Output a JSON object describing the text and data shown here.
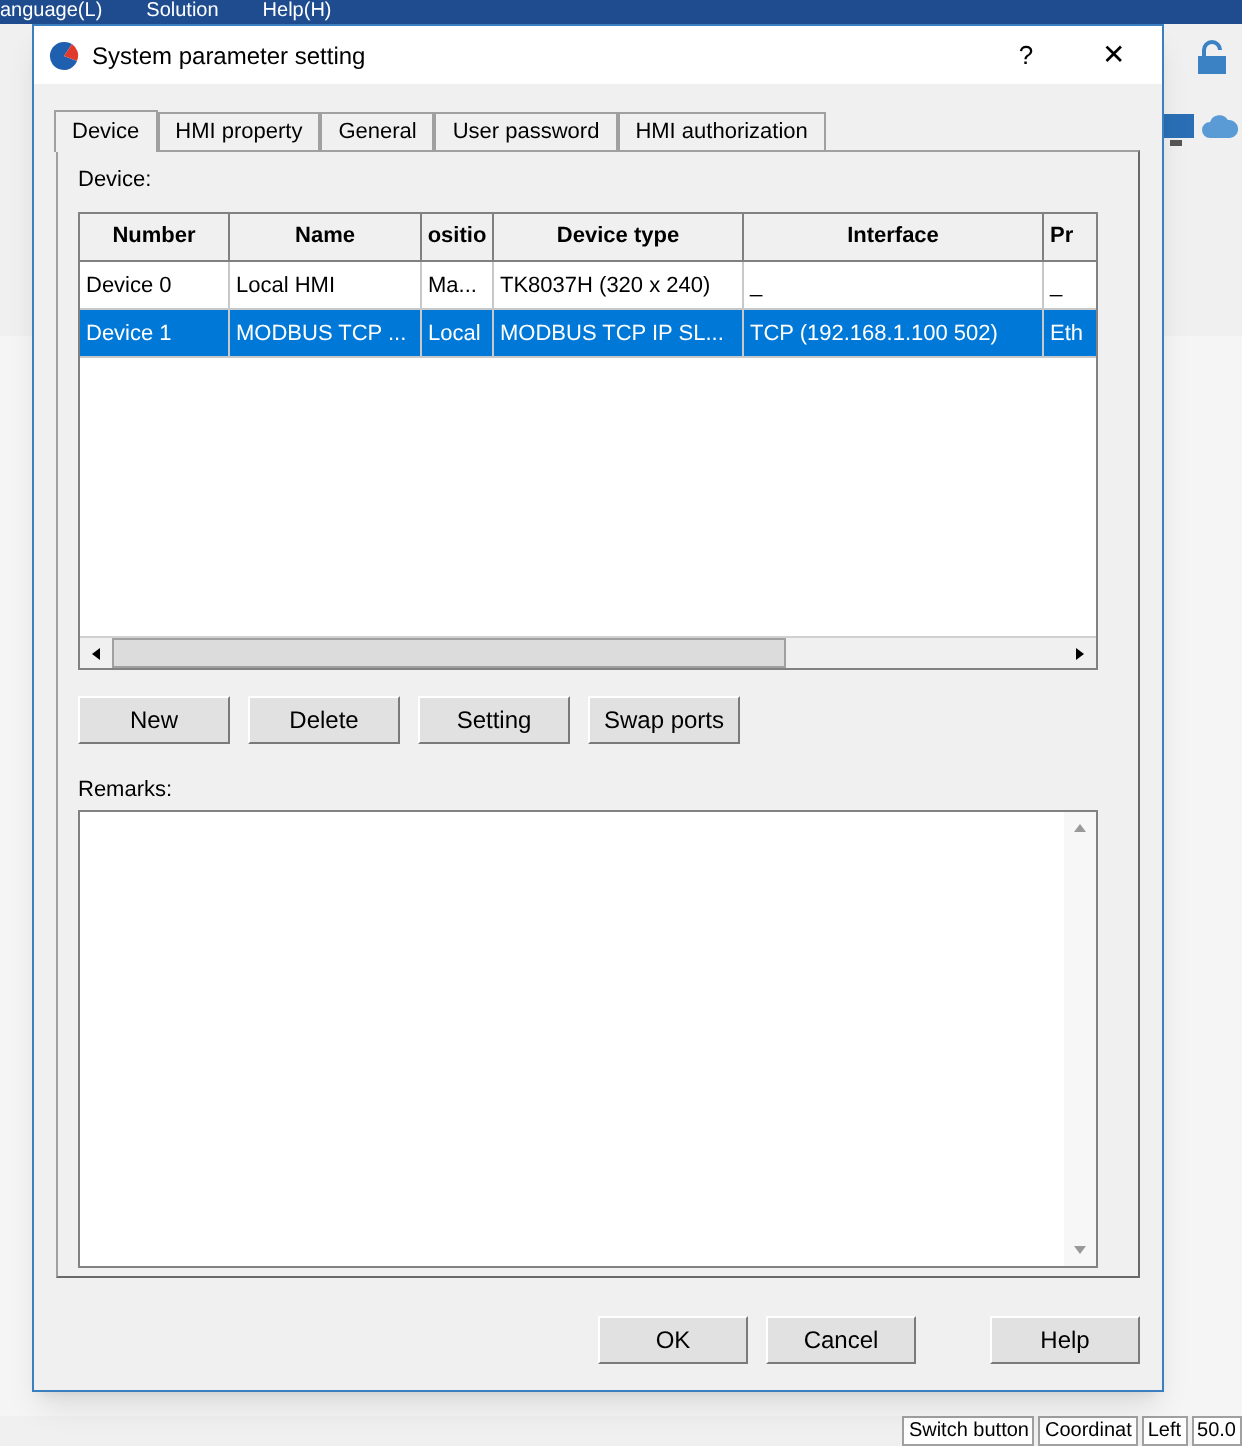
{
  "background_menu": [
    "anguage(L)",
    "Solution",
    "Help(H)"
  ],
  "window": {
    "title": "System parameter setting",
    "help_glyph": "?",
    "close_glyph": "✕"
  },
  "tabs": [
    {
      "label": "Device",
      "selected": true
    },
    {
      "label": "HMI property",
      "selected": false
    },
    {
      "label": "General",
      "selected": false
    },
    {
      "label": "User password",
      "selected": false
    },
    {
      "label": "HMI authorization",
      "selected": false
    }
  ],
  "device_label": "Device:",
  "table": {
    "columns": [
      "Number",
      "Name",
      "ositio",
      "Device type",
      "Interface",
      "Pr"
    ],
    "rows": [
      {
        "cells": [
          "Device 0",
          "Local HMI",
          "Ma...",
          "TK8037H (320 x 240)",
          "_",
          "_"
        ],
        "selected": false
      },
      {
        "cells": [
          "Device 1",
          "MODBUS TCP ...",
          "Local",
          "MODBUS TCP IP SL...",
          "TCP (192.168.1.100  502)",
          "Eth"
        ],
        "selected": true
      }
    ]
  },
  "device_buttons": [
    "New",
    "Delete",
    "Setting",
    "Swap ports"
  ],
  "remarks_label": "Remarks:",
  "dialog_buttons": [
    "OK",
    "Cancel",
    "Help"
  ],
  "status_bar": [
    "Switch button",
    "Coordinat",
    "Left",
    "50.0"
  ]
}
